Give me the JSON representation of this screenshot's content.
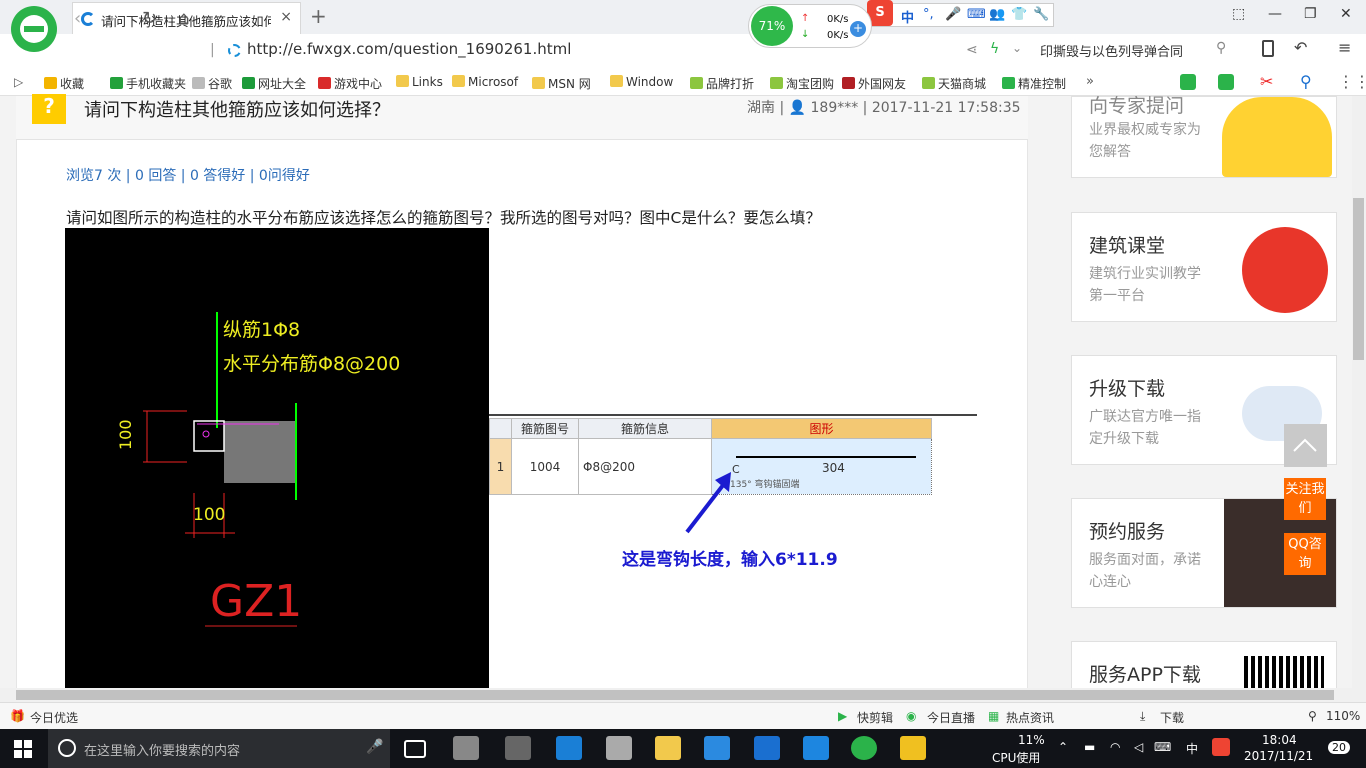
{
  "browser": {
    "tab_title": "请问下构造柱其他箍筋应该如何选",
    "tab_close": "×",
    "new_tab": "+",
    "perf_percent": "71%",
    "net_up": "0K/s",
    "net_down": "0K/s",
    "net_plus": "+",
    "ime_items": [
      "中",
      "°,",
      "🎤",
      "⌨",
      "👥",
      "👕",
      "🔧"
    ],
    "ime_brand": "S",
    "url": "http://e.fwxgx.com/question_1690261.html",
    "search_text": "印撕毁与以色列导弹合同",
    "window_controls": [
      "⬚",
      "—",
      "❐",
      "✕"
    ]
  },
  "bookmarks": [
    {
      "label": "收藏",
      "color": "#f3b400"
    },
    {
      "label": "手机收藏夹",
      "color": "#23a13b"
    },
    {
      "label": "谷歌",
      "color": "#bbbbbb"
    },
    {
      "label": "网址大全",
      "color": "#1d9b3a"
    },
    {
      "label": "游戏中心",
      "color": "#d92b2b"
    },
    {
      "label": "Links",
      "color": "#f2c94c"
    },
    {
      "label": "Microsof",
      "color": "#f2c94c"
    },
    {
      "label": "MSN 网",
      "color": "#f2c94c"
    },
    {
      "label": "Window",
      "color": "#f2c94c"
    },
    {
      "label": "品牌打折",
      "color": "#8cc63f"
    },
    {
      "label": "淘宝团购",
      "color": "#8cc63f"
    },
    {
      "label": "外国网友",
      "color": "#b11f24"
    },
    {
      "label": "天猫商城",
      "color": "#8cc63f"
    },
    {
      "label": "精准控制",
      "color": "#2bb34a"
    }
  ],
  "bookmarks_more": "»",
  "question": {
    "mark": "?",
    "title": "请问下构造柱其他箍筋应该如何选择？",
    "meta": "湖南 | 👤 189*** | 2017-11-21 17:58:35",
    "stats": "浏览7 次 | 0 回答 | 0 答得好 | 0问得好",
    "body": "请问如图所示的构造柱的水平分布筋应该选择怎么的箍筋图号？我所选的图号对吗？图中C是什么？要怎么填？"
  },
  "cad": {
    "rebar1": "纵筋1Φ8",
    "rebar2": "水平分布筋Φ8@200",
    "dim_v": "100",
    "dim_h": "100",
    "label": "GZ1"
  },
  "spreadsheet": {
    "headers": [
      "",
      "箍筋图号",
      "箍筋信息",
      "图形"
    ],
    "row": {
      "index": "1",
      "code": "1004",
      "info": "Φ8@200",
      "shape_value": "304",
      "shape_c": "C",
      "shape_note": "135° 弯钩锚固端"
    }
  },
  "annotation": "这是弯钩长度，输入6*11.9",
  "sidebar": {
    "cards": [
      {
        "title": "向专家提问",
        "sub": "业界最权威专家为您解答"
      },
      {
        "title": "建筑课堂",
        "sub": "建筑行业实训教学第一平台"
      },
      {
        "title": "升级下载",
        "sub": "广联达官方唯一指定升级下载"
      },
      {
        "title": "预约服务",
        "sub": "服务面对面，承诺心连心"
      },
      {
        "title": "服务APP下载",
        "sub": ""
      }
    ],
    "follow": "关注我们",
    "qq": "QQ咨询"
  },
  "statusbar": {
    "left": "今日优选",
    "items": [
      "快剪辑",
      "今日直播",
      "热点资讯",
      "下载"
    ],
    "zoom": "110%"
  },
  "taskbar": {
    "search_placeholder": "在这里输入你要搜索的内容",
    "cpu_percent": "11%",
    "cpu_label": "CPU使用",
    "ime": "中",
    "time": "18:04",
    "date": "2017/11/21",
    "notifications": "20"
  },
  "colors": {
    "accent": "#2bb34a",
    "link": "#2b6cb8",
    "annotation": "#1b1bd0",
    "orange": "#ff6a00"
  }
}
